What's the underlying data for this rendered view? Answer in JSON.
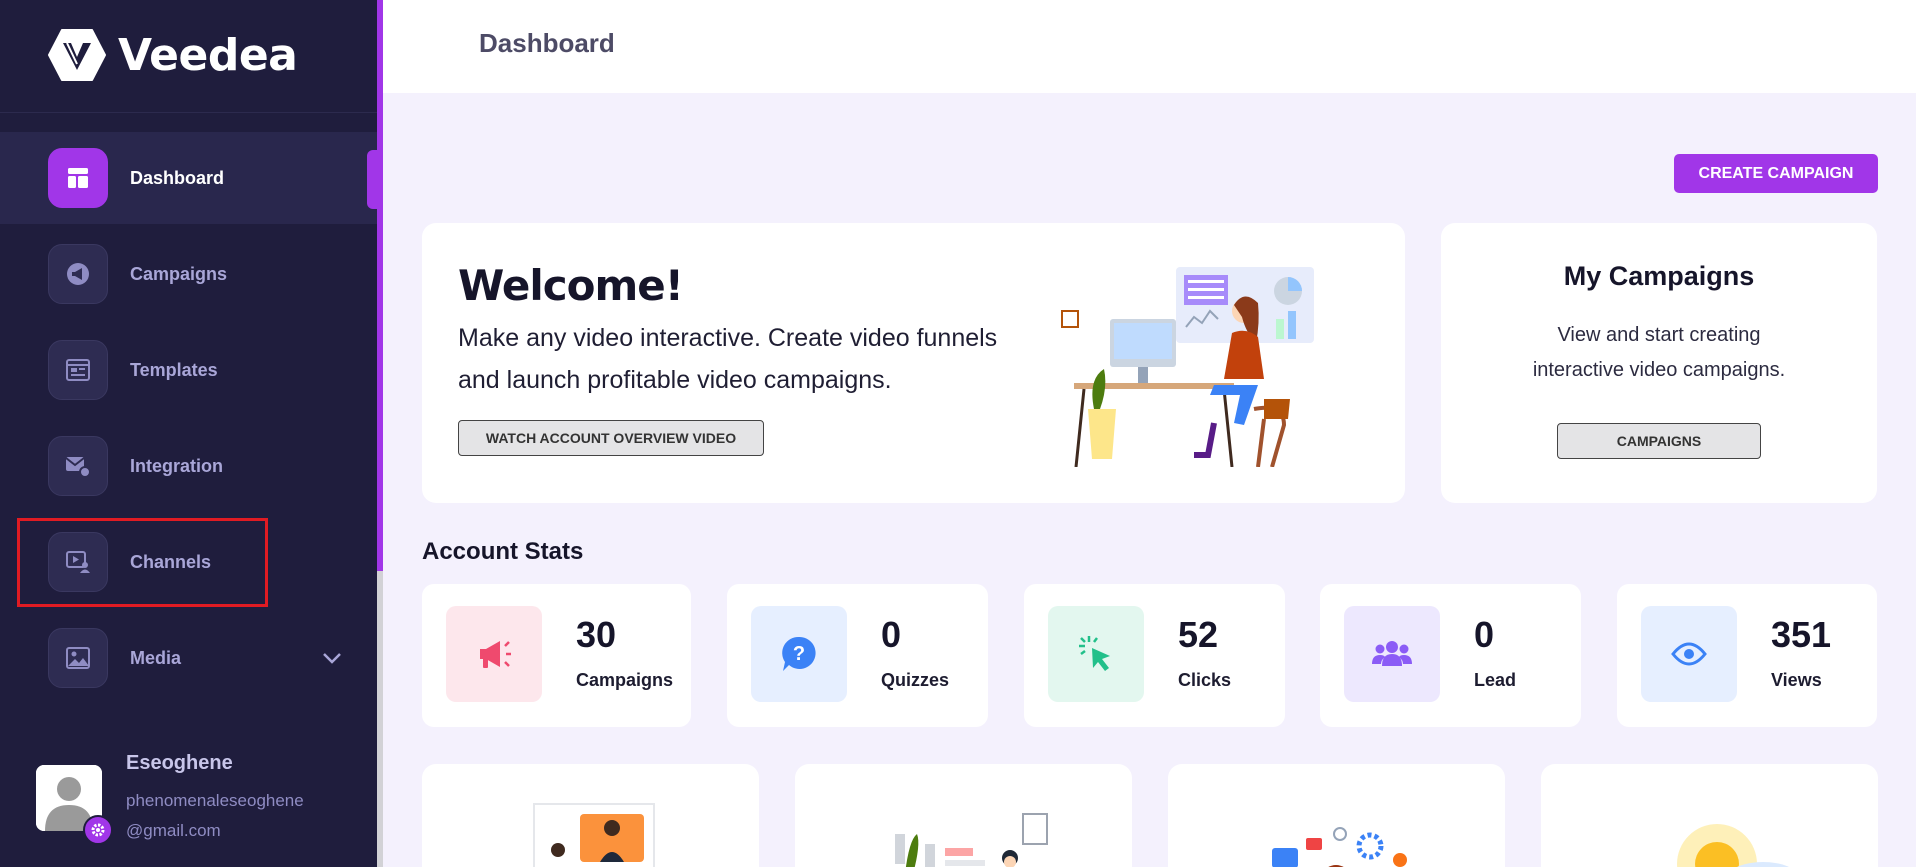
{
  "app": {
    "name": "Veedea"
  },
  "sidebar": {
    "items": [
      {
        "label": "Dashboard",
        "icon": "dashboard-icon",
        "active": true
      },
      {
        "label": "Campaigns",
        "icon": "megaphone-icon"
      },
      {
        "label": "Templates",
        "icon": "templates-icon"
      },
      {
        "label": "Integration",
        "icon": "integration-icon"
      },
      {
        "label": "Channels",
        "icon": "channels-icon"
      },
      {
        "label": "Media",
        "icon": "media-icon",
        "expandable": true
      }
    ]
  },
  "user": {
    "name": "Eseoghene",
    "email_user": "phenomenaleseoghene",
    "email_domain": "@gmail.com"
  },
  "header": {
    "title": "Dashboard"
  },
  "actions": {
    "create_campaign": "CREATE CAMPAIGN"
  },
  "welcome": {
    "title": "Welcome!",
    "text": "Make any video interactive. Create video funnels and launch profitable video campaigns.",
    "button": "WATCH ACCOUNT OVERVIEW VIDEO"
  },
  "my_campaigns": {
    "title": "My Campaigns",
    "text": "View and start creating interactive video campaigns.",
    "button": "CAMPAIGNS"
  },
  "stats": {
    "title": "Account Stats",
    "items": [
      {
        "value": "30",
        "label": "Campaigns",
        "icon": "megaphone-icon",
        "color": "#ef4a6e",
        "bg": "#fde7ec"
      },
      {
        "value": "0",
        "label": "Quizzes",
        "icon": "question-icon",
        "color": "#3b82f6",
        "bg": "#e6efff"
      },
      {
        "value": "52",
        "label": "Clicks",
        "icon": "cursor-click-icon",
        "color": "#22c08a",
        "bg": "#e3f7ef"
      },
      {
        "value": "0",
        "label": "Lead",
        "icon": "users-icon",
        "color": "#8b5cf6",
        "bg": "#ede8fe"
      },
      {
        "value": "351",
        "label": "Views",
        "icon": "eye-icon",
        "color": "#3b82f6",
        "bg": "#e6efff"
      }
    ]
  },
  "colors": {
    "accent": "#a136e8",
    "sidebar": "#1f1d3d",
    "background": "#f4f1fd"
  }
}
